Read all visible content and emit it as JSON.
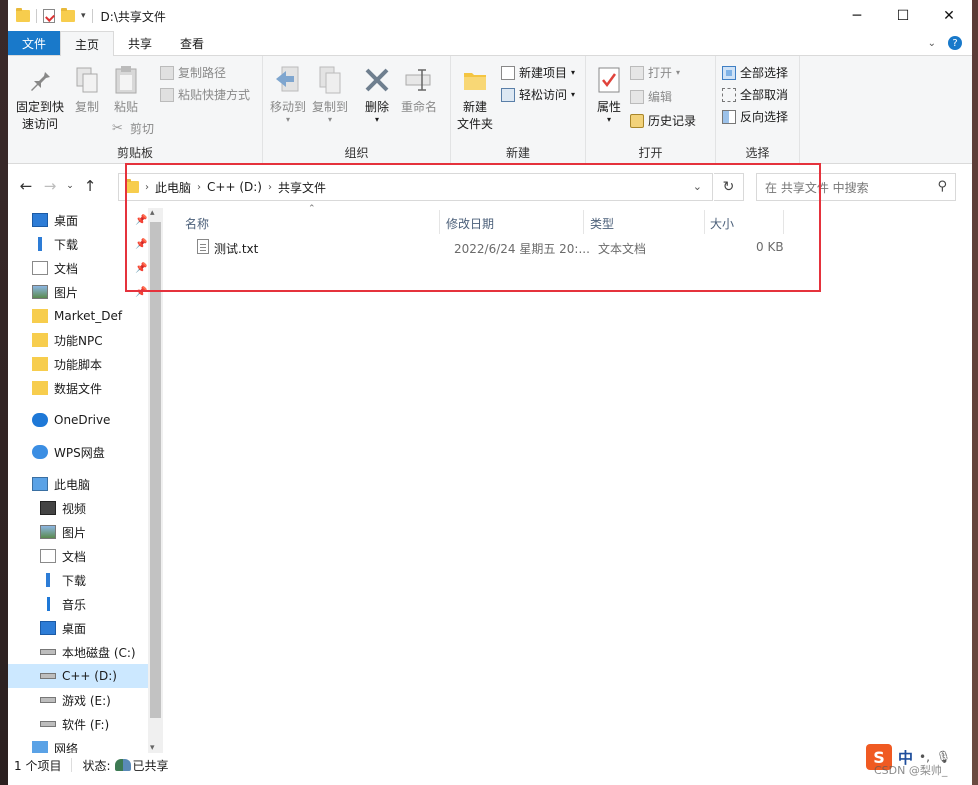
{
  "window": {
    "title": "D:\\共享文件"
  },
  "tabs": [
    "文件",
    "主页",
    "共享",
    "查看"
  ],
  "ribbon": {
    "clipboard": {
      "label": "剪贴板",
      "pin_line1": "固定到快",
      "pin_line2": "速访问",
      "copy": "复制",
      "paste": "粘贴",
      "copy_path": "复制路径",
      "paste_shortcut": "粘贴快捷方式",
      "cut": "剪切"
    },
    "organize": {
      "label": "组织",
      "move_to": "移动到",
      "copy_to": "复制到",
      "delete": "删除",
      "rename": "重命名"
    },
    "new": {
      "label": "新建",
      "new_folder_line1": "新建",
      "new_folder_line2": "文件夹",
      "new_item": "新建项目",
      "easy_access": "轻松访问"
    },
    "open": {
      "label": "打开",
      "properties": "属性",
      "open": "打开",
      "edit": "编辑",
      "history": "历史记录"
    },
    "select": {
      "label": "选择",
      "select_all": "全部选择",
      "select_none": "全部取消",
      "invert": "反向选择"
    }
  },
  "address": {
    "crumbs": [
      "此电脑",
      "C++ (D:)",
      "共享文件"
    ]
  },
  "search": {
    "placeholder": "在 共享文件 中搜索"
  },
  "nav_pane": {
    "items": [
      {
        "label": "桌面",
        "icon": "desktop-icon",
        "pinned": true
      },
      {
        "label": "下载",
        "icon": "download-icon",
        "pinned": true
      },
      {
        "label": "文档",
        "icon": "document-icon",
        "pinned": true
      },
      {
        "label": "图片",
        "icon": "picture-icon",
        "pinned": true
      },
      {
        "label": "Market_Def",
        "icon": "folder-icon"
      },
      {
        "label": "功能NPC",
        "icon": "folder-icon"
      },
      {
        "label": "功能脚本",
        "icon": "folder-icon"
      },
      {
        "label": "数据文件",
        "icon": "folder-icon"
      },
      {
        "label": "OneDrive",
        "icon": "onedrive-icon"
      },
      {
        "label": "WPS网盘",
        "icon": "cloud-icon"
      },
      {
        "label": "此电脑",
        "icon": "computer-icon"
      },
      {
        "label": "视频",
        "icon": "video-icon"
      },
      {
        "label": "图片",
        "icon": "picture-icon"
      },
      {
        "label": "文档",
        "icon": "document-icon"
      },
      {
        "label": "下载",
        "icon": "download-icon"
      },
      {
        "label": "音乐",
        "icon": "music-icon"
      },
      {
        "label": "桌面",
        "icon": "desktop-icon"
      },
      {
        "label": "本地磁盘 (C:)",
        "icon": "drive-icon"
      },
      {
        "label": "C++ (D:)",
        "icon": "drive-icon",
        "selected": true
      },
      {
        "label": "游戏 (E:)",
        "icon": "drive-icon"
      },
      {
        "label": "软件 (F:)",
        "icon": "drive-icon"
      },
      {
        "label": "网络",
        "icon": "network-icon"
      }
    ]
  },
  "columns": [
    "名称",
    "修改日期",
    "类型",
    "大小"
  ],
  "files": [
    {
      "name": "测试.txt",
      "modified": "2022/6/24 星期五 20:...",
      "type": "文本文档",
      "size": "0 KB"
    }
  ],
  "status": {
    "count": "1 个项目",
    "state_label": "状态:",
    "state_value": "已共享"
  },
  "overlay": {
    "ime_logo": "S",
    "ime_mode": "中",
    "watermark": "CSDN @梨帅_"
  },
  "colors": {
    "accent": "#1979ca",
    "highlight_box": "#e5323c",
    "selected_bg": "#cce8ff"
  }
}
